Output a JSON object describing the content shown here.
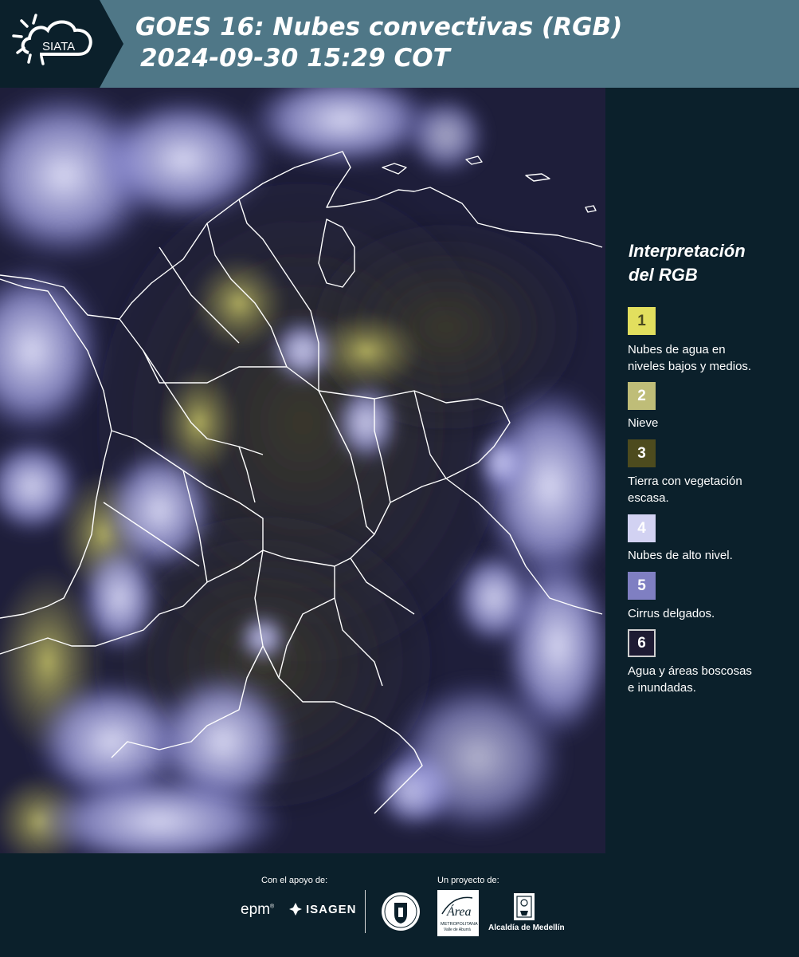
{
  "header": {
    "logo_text": "SIATA",
    "title": "GOES 16: Nubes convectivas (RGB)",
    "timestamp": "2024-09-30 15:29 COT",
    "background_color": "#4f7787"
  },
  "map": {
    "description_icon": "satellite-rgb-map",
    "background_color": "#1d1d3c"
  },
  "legend": {
    "title_line1": "Interpretación",
    "title_line2": "del RGB",
    "items": [
      {
        "number": "1",
        "line1": "Nubes de agua en",
        "line2": "niveles bajos y medios.",
        "color": "#e2df5e",
        "text_color": "#4a4a20"
      },
      {
        "number": "2",
        "line1": "Nieve",
        "line2": "",
        "color": "#bfbd78",
        "text_color": "#ffffff"
      },
      {
        "number": "3",
        "line1": "Tierra con vegetación",
        "line2": "escasa.",
        "color": "#4d4b1e",
        "text_color": "#ffffff"
      },
      {
        "number": "4",
        "line1": "Nubes de alto nivel.",
        "line2": "",
        "color": "#d2d2f2",
        "text_color": "#ffffff"
      },
      {
        "number": "5",
        "line1": "Cirrus delgados.",
        "line2": "",
        "color": "#7f7fc2",
        "text_color": "#ffffff"
      },
      {
        "number": "6",
        "line1": "Agua y áreas boscosas",
        "line2": "e inundadas.",
        "color": "#1e1b33",
        "text_color": "#ffffff"
      }
    ]
  },
  "footer": {
    "support_label": "Con el apoyo de:",
    "project_label": "Un proyecto de:",
    "sponsor1": "epm",
    "sponsor2": "ISAGEN",
    "partner_area_line1": "Área",
    "partner_area_line2": "METROPOLITANA",
    "partner_area_line3": "Valle de Aburrá",
    "partner_city": "Alcaldía de Medellín"
  }
}
